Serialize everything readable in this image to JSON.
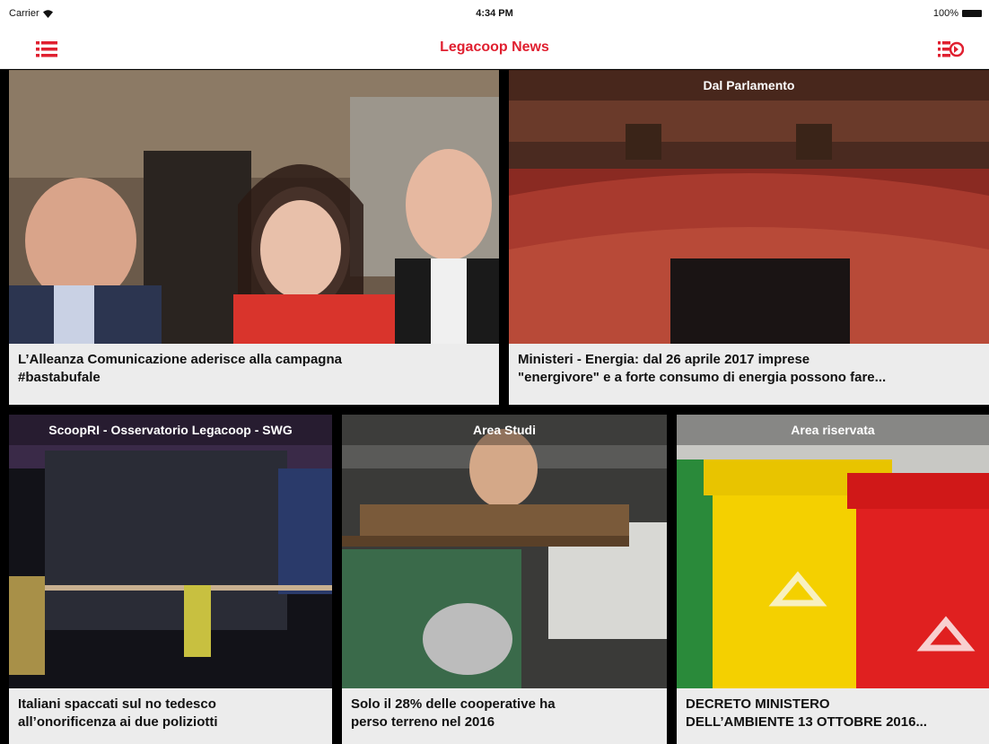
{
  "statusbar": {
    "carrier": "Carrier",
    "time": "4:34 PM",
    "battery": "100%"
  },
  "navbar": {
    "title": "Legacoop News",
    "menu_icon": "list-icon",
    "logout_icon": "logout-icon"
  },
  "articles": [
    {
      "category": "",
      "title_line1": "L’Alleanza Comunicazione aderisce alla campagna",
      "title_line2": "#bastabufale"
    },
    {
      "category": "Dal Parlamento",
      "title_line1": "Ministeri - Energia: dal 26 aprile 2017 imprese",
      "title_line2": "\"energivore\" e a forte consumo di energia possono fare..."
    },
    {
      "category": "ScoopRI - Osservatorio Legacoop - SWG",
      "title_line1": "Italiani spaccati sul no tedesco",
      "title_line2": "all’onorificenza ai due poliziotti"
    },
    {
      "category": "Area Studi",
      "title_line1": "Solo il 28% delle cooperative ha",
      "title_line2": "perso terreno nel 2016"
    },
    {
      "category": "Area riservata",
      "title_line1": "DECRETO MINISTERO",
      "title_line2": "DELL’AMBIENTE 13 OTTOBRE 2016..."
    }
  ],
  "colors": {
    "accent": "#e02030",
    "caption_bg": "#ececec"
  }
}
